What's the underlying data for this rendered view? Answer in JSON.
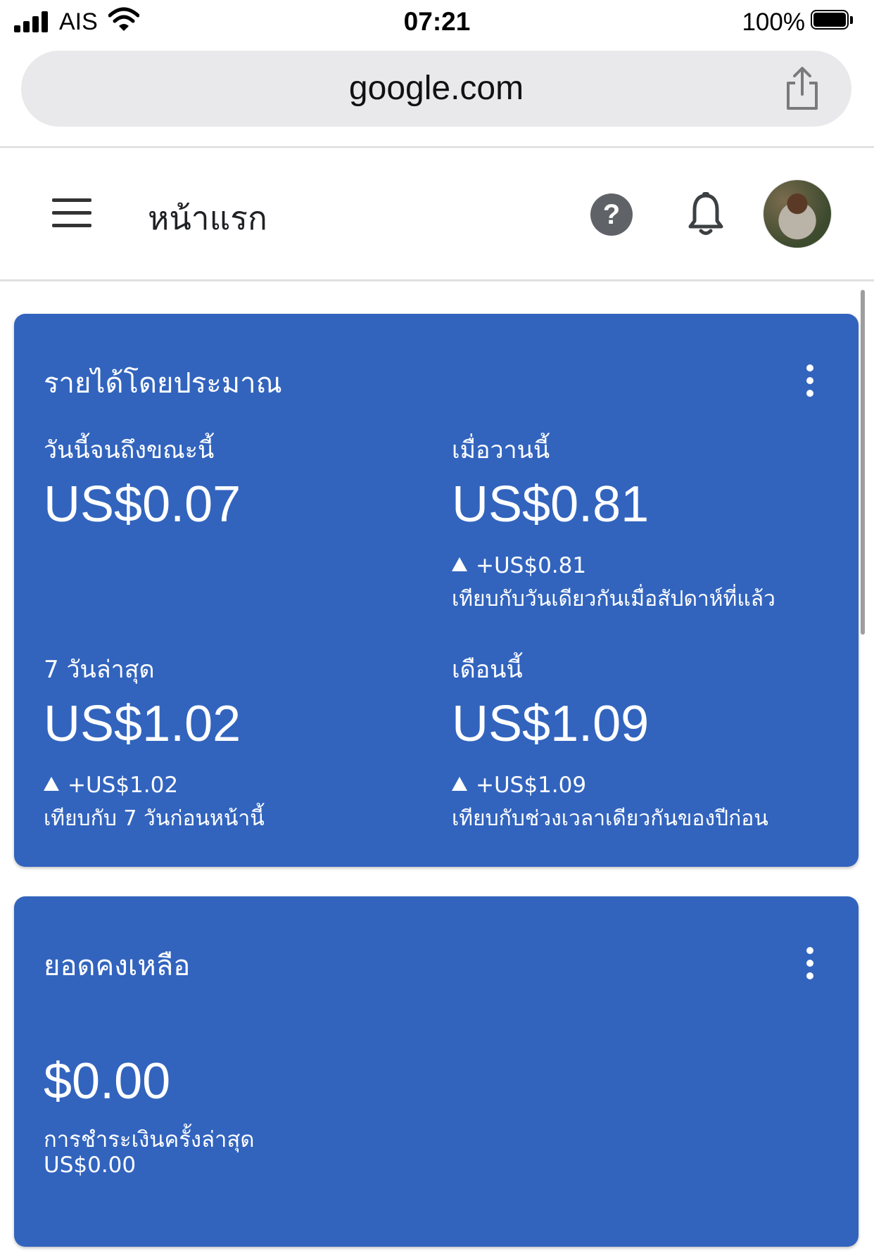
{
  "status_bar": {
    "carrier": "AIS",
    "time": "07:21",
    "battery_percent": "100%"
  },
  "browser": {
    "url": "google.com",
    "share_icon": "share-icon"
  },
  "header": {
    "menu_icon": "menu-icon",
    "title": "หน้าแรก",
    "help_icon": "help-icon",
    "bell_icon": "bell-icon"
  },
  "earnings": {
    "title": "รายได้โดยประมาณ",
    "today": {
      "label": "วันนี้จนถึงขณะนี้",
      "value": "US$0.07"
    },
    "yesterday": {
      "label": "เมื่อวานนี้",
      "value": "US$0.81",
      "delta": "+US$0.81",
      "compare": "เทียบกับวันเดียวกันเมื่อสัปดาห์ที่แล้ว"
    },
    "last7": {
      "label": "7 วันล่าสุด",
      "value": "US$1.02",
      "delta": "+US$1.02",
      "compare": "เทียบกับ 7 วันก่อนหน้านี้"
    },
    "month": {
      "label": "เดือนนี้",
      "value": "US$1.09",
      "delta": "+US$1.09",
      "compare": "เทียบกับช่วงเวลาเดียวกันของปีก่อน"
    }
  },
  "balance": {
    "title": "ยอดคงเหลือ",
    "value": "$0.00",
    "last_payment_label": "การชำระเงินครั้งล่าสุด",
    "last_payment_value": "US$0.00"
  },
  "colors": {
    "card_blue": "#3264be",
    "text_dark": "#202124"
  }
}
